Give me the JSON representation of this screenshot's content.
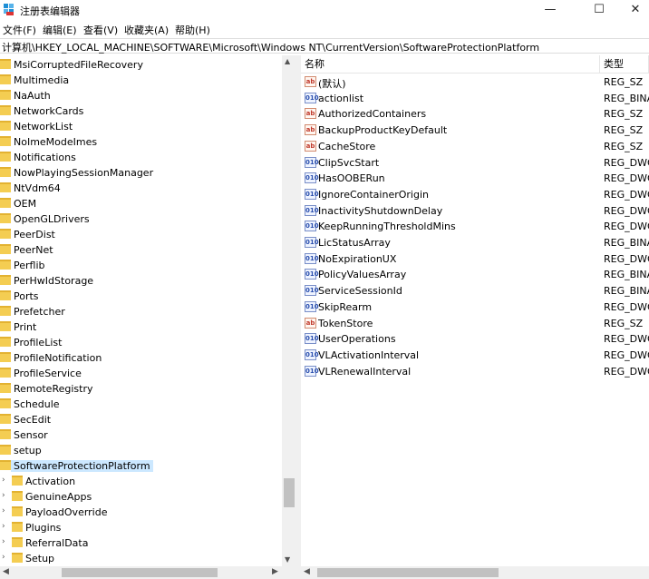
{
  "window": {
    "title": "注册表编辑器",
    "minimize_glyph": "—",
    "maximize_glyph": "☐",
    "close_glyph": "✕"
  },
  "menu": [
    "文件(F)",
    "编辑(E)",
    "查看(V)",
    "收藏夹(A)",
    "帮助(H)"
  ],
  "address": "计算机\\HKEY_LOCAL_MACHINE\\SOFTWARE\\Microsoft\\Windows NT\\CurrentVersion\\SoftwareProtectionPlatform",
  "tree": {
    "items": [
      "MsiCorruptedFileRecovery",
      "Multimedia",
      "NaAuth",
      "NetworkCards",
      "NetworkList",
      "NoImeModeImes",
      "Notifications",
      "NowPlayingSessionManager",
      "NtVdm64",
      "OEM",
      "OpenGLDrivers",
      "PeerDist",
      "PeerNet",
      "Perflib",
      "PerHwIdStorage",
      "Ports",
      "Prefetcher",
      "Print",
      "ProfileList",
      "ProfileNotification",
      "ProfileService",
      "RemoteRegistry",
      "Schedule",
      "SecEdit",
      "Sensor",
      "setup",
      "SoftwareProtectionPlatform"
    ],
    "selected": "SoftwareProtectionPlatform",
    "children": [
      "Activation",
      "GenuineApps",
      "PayloadOverride",
      "Plugins",
      "ReferralData",
      "Setup"
    ]
  },
  "values": {
    "col_name": "名称",
    "col_type": "类型",
    "rows": [
      {
        "name": "(默认)",
        "type": "REG_SZ",
        "icon": "ab"
      },
      {
        "name": "actionlist",
        "type": "REG_BINA",
        "icon": "bin"
      },
      {
        "name": "AuthorizedContainers",
        "type": "REG_SZ",
        "icon": "ab"
      },
      {
        "name": "BackupProductKeyDefault",
        "type": "REG_SZ",
        "icon": "ab"
      },
      {
        "name": "CacheStore",
        "type": "REG_SZ",
        "icon": "ab"
      },
      {
        "name": "ClipSvcStart",
        "type": "REG_DWO",
        "icon": "bin"
      },
      {
        "name": "HasOOBERun",
        "type": "REG_DWO",
        "icon": "bin"
      },
      {
        "name": "IgnoreContainerOrigin",
        "type": "REG_DWO",
        "icon": "bin"
      },
      {
        "name": "InactivityShutdownDelay",
        "type": "REG_DWO",
        "icon": "bin"
      },
      {
        "name": "KeepRunningThresholdMins",
        "type": "REG_DWO",
        "icon": "bin"
      },
      {
        "name": "LicStatusArray",
        "type": "REG_BINA",
        "icon": "bin"
      },
      {
        "name": "NoExpirationUX",
        "type": "REG_DWO",
        "icon": "bin"
      },
      {
        "name": "PolicyValuesArray",
        "type": "REG_BINA",
        "icon": "bin"
      },
      {
        "name": "ServiceSessionId",
        "type": "REG_BINA",
        "icon": "bin"
      },
      {
        "name": "SkipRearm",
        "type": "REG_DWO",
        "icon": "bin"
      },
      {
        "name": "TokenStore",
        "type": "REG_SZ",
        "icon": "ab"
      },
      {
        "name": "UserOperations",
        "type": "REG_DWO",
        "icon": "bin"
      },
      {
        "name": "VLActivationInterval",
        "type": "REG_DWO",
        "icon": "bin"
      },
      {
        "name": "VLRenewalInterval",
        "type": "REG_DWO",
        "icon": "bin"
      }
    ]
  },
  "icons": {
    "string_value": "ab",
    "binary_value": "010"
  }
}
